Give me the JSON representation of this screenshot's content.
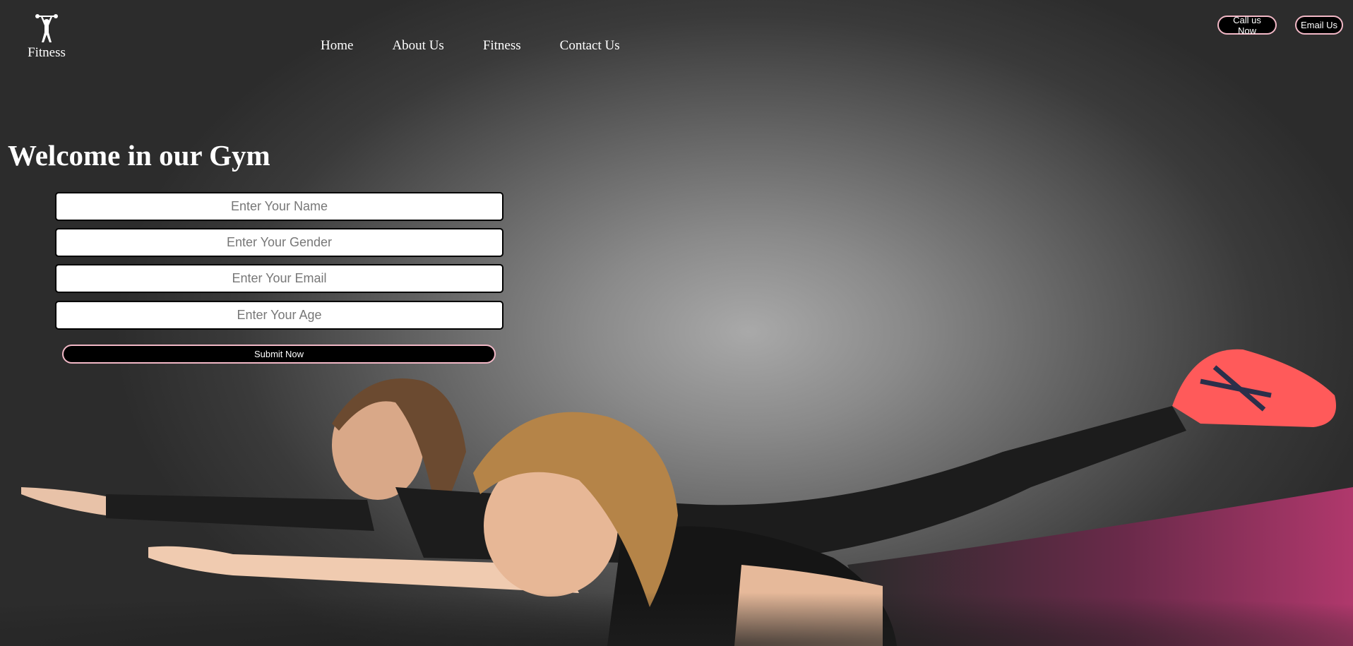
{
  "logo": {
    "text": "Fitness",
    "icon": "weightlifter-icon"
  },
  "nav": {
    "items": [
      "Home",
      "About Us",
      "Fitness",
      "Contact Us"
    ]
  },
  "top_buttons": {
    "call": "Call us Now",
    "email": "Email Us"
  },
  "hero": {
    "title": "Welcome in our Gym"
  },
  "form": {
    "name_placeholder": "Enter Your Name",
    "gender_placeholder": "Enter Your Gender",
    "email_placeholder": "Enter Your Email",
    "age_placeholder": "Enter Your Age",
    "submit_label": "Submit Now"
  },
  "colors": {
    "button_border": "#f2b8c6",
    "button_bg": "#000000",
    "text": "#ffffff"
  }
}
